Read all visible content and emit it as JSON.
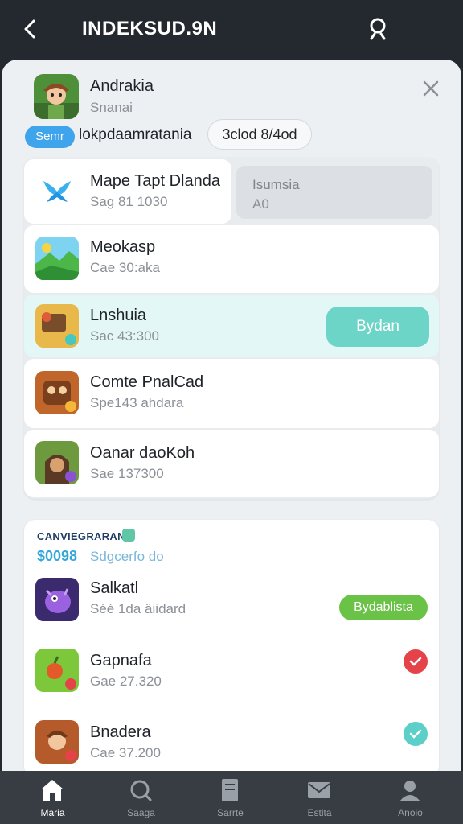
{
  "header": {
    "title": "INDEKSUD.9N"
  },
  "sheet": {
    "app_name": "Andrakia",
    "app_sub": "Snanai",
    "tag_pill": "Semr",
    "tag_text": "lokpdaamratania",
    "tag_outline": "3clod 8/4od"
  },
  "list": [
    {
      "name": "Mape Tapt Dlanda",
      "sub": "Sag 81 1030"
    },
    {
      "name": "Meokasp",
      "sub": "Cae 30:aka"
    },
    {
      "name": "Lnshuia",
      "sub": "Sac 43:300"
    },
    {
      "name": "Comte PnalCad",
      "sub": "Spe143 ahdara"
    },
    {
      "name": "Oanar daoKoh",
      "sub": "Sae 137300"
    }
  ],
  "row1_side": {
    "title": "Isumsia",
    "sub": "A0"
  },
  "teal_button": "Bydan",
  "section": {
    "title": "CANVIEGRARAN",
    "price": "$0098",
    "price_sub": "Sdgcerfo do"
  },
  "list2": [
    {
      "name": "Salkatl",
      "sub": "Séé 1da äiidard"
    },
    {
      "name": "Gapnafa",
      "sub": "Gae 27.320"
    },
    {
      "name": "Bnadera",
      "sub": "Cae 37.200"
    }
  ],
  "green_button": "Bydablista",
  "nav": [
    {
      "label": "Maria",
      "icon": "home-icon"
    },
    {
      "label": "Saaga",
      "icon": "search-icon"
    },
    {
      "label": "Sarrte",
      "icon": "document-icon"
    },
    {
      "label": "Estita",
      "icon": "mail-icon"
    },
    {
      "label": "Anoio",
      "icon": "user-icon"
    }
  ],
  "colors": {
    "topbar": "#24282f",
    "accent_blue": "#3ea4ec",
    "accent_teal": "#6dd5c7",
    "accent_green": "#6ac247",
    "status_red": "#e5434a",
    "status_teal": "#5cd0c8"
  }
}
